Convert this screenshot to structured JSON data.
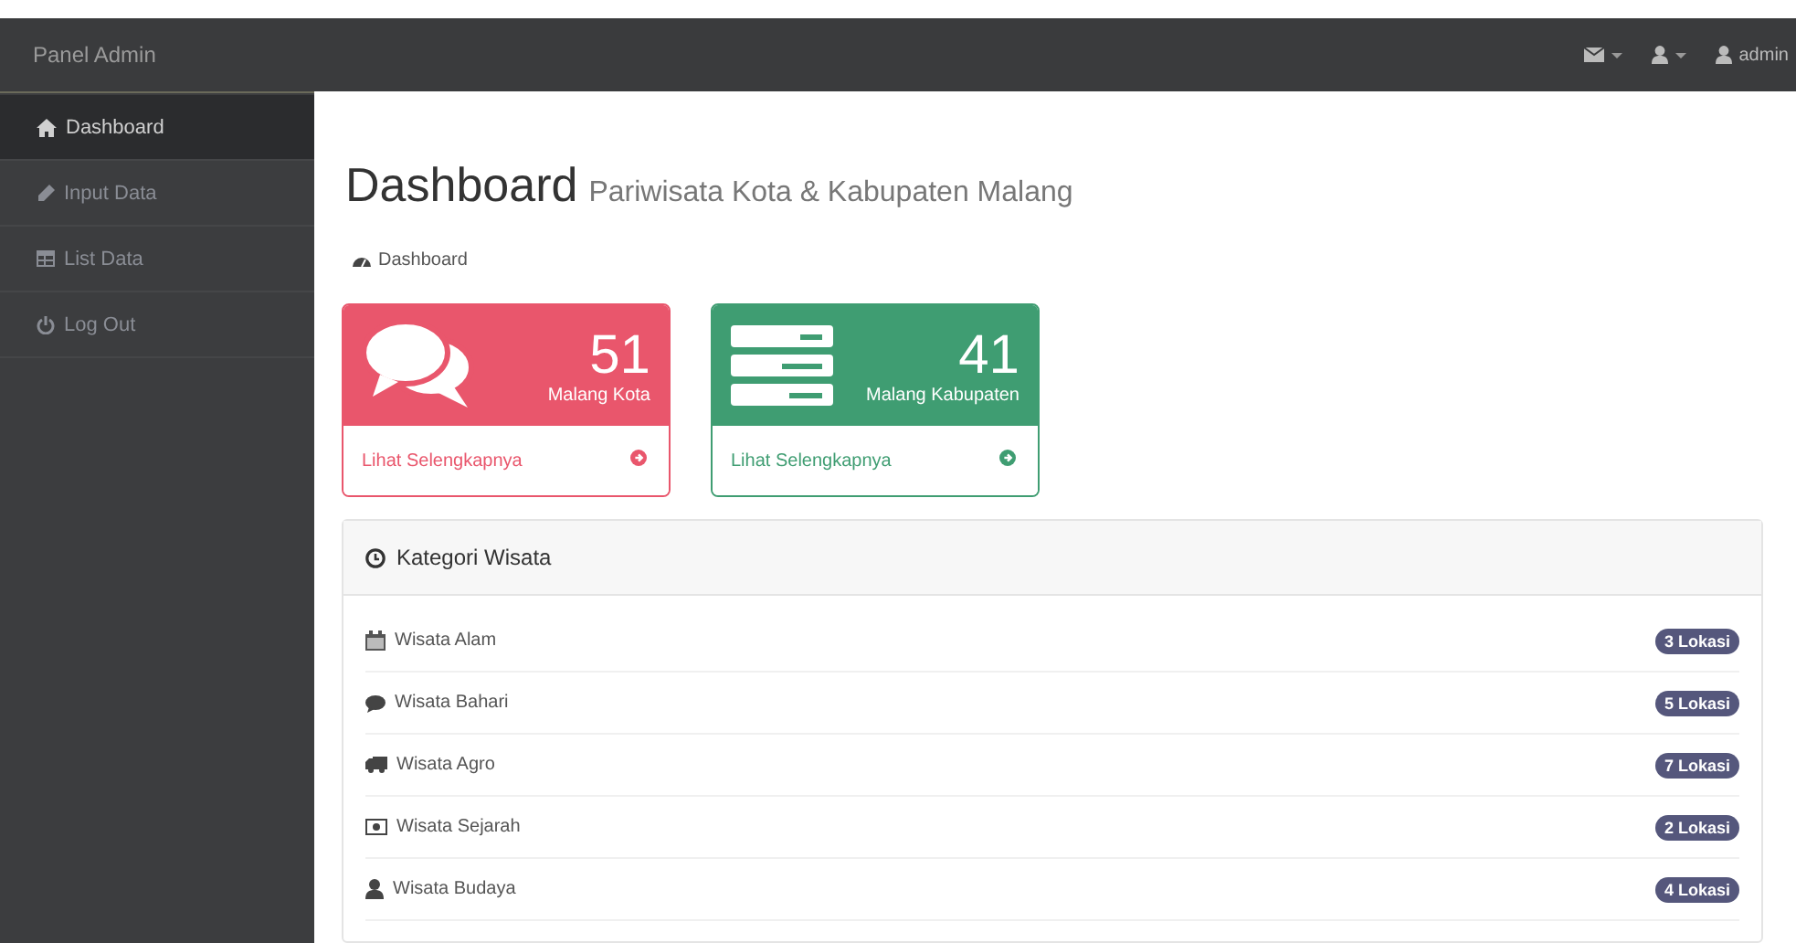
{
  "navbar": {
    "brand": "Panel Admin",
    "user": "admin"
  },
  "sidebar": {
    "items": [
      {
        "kind": "home",
        "label": "Dashboard",
        "selected": true
      },
      {
        "kind": "edit",
        "label": "Input Data",
        "selected": false
      },
      {
        "kind": "table",
        "label": "List Data",
        "selected": false
      },
      {
        "kind": "power",
        "label": "Log Out",
        "selected": false
      }
    ]
  },
  "header": {
    "title": "Dashboard",
    "subtitle": "Pariwisata Kota & Kabupaten Malang"
  },
  "breadcrumb": "Dashboard",
  "stat_cards": [
    {
      "kind": "comments",
      "count": "51",
      "label": "Malang Kota",
      "link": "Lihat Selengkapnya",
      "color": "#e9566c"
    },
    {
      "kind": "servers",
      "count": "41",
      "label": "Malang Kabupaten",
      "link": "Lihat Selengkapnya",
      "color": "#3f9d72"
    }
  ],
  "category_panel": {
    "title": "Kategori Wisata",
    "items": [
      {
        "kind": "calendar",
        "label": "Wisata Alam",
        "badge": "3 Lokasi"
      },
      {
        "kind": "comment",
        "label": "Wisata Bahari",
        "badge": "5 Lokasi"
      },
      {
        "kind": "truck",
        "label": "Wisata Agro",
        "badge": "7 Lokasi"
      },
      {
        "kind": "money",
        "label": "Wisata Sejarah",
        "badge": "2 Lokasi"
      },
      {
        "kind": "user",
        "label": "Wisata Budaya",
        "badge": "4 Lokasi"
      }
    ]
  }
}
